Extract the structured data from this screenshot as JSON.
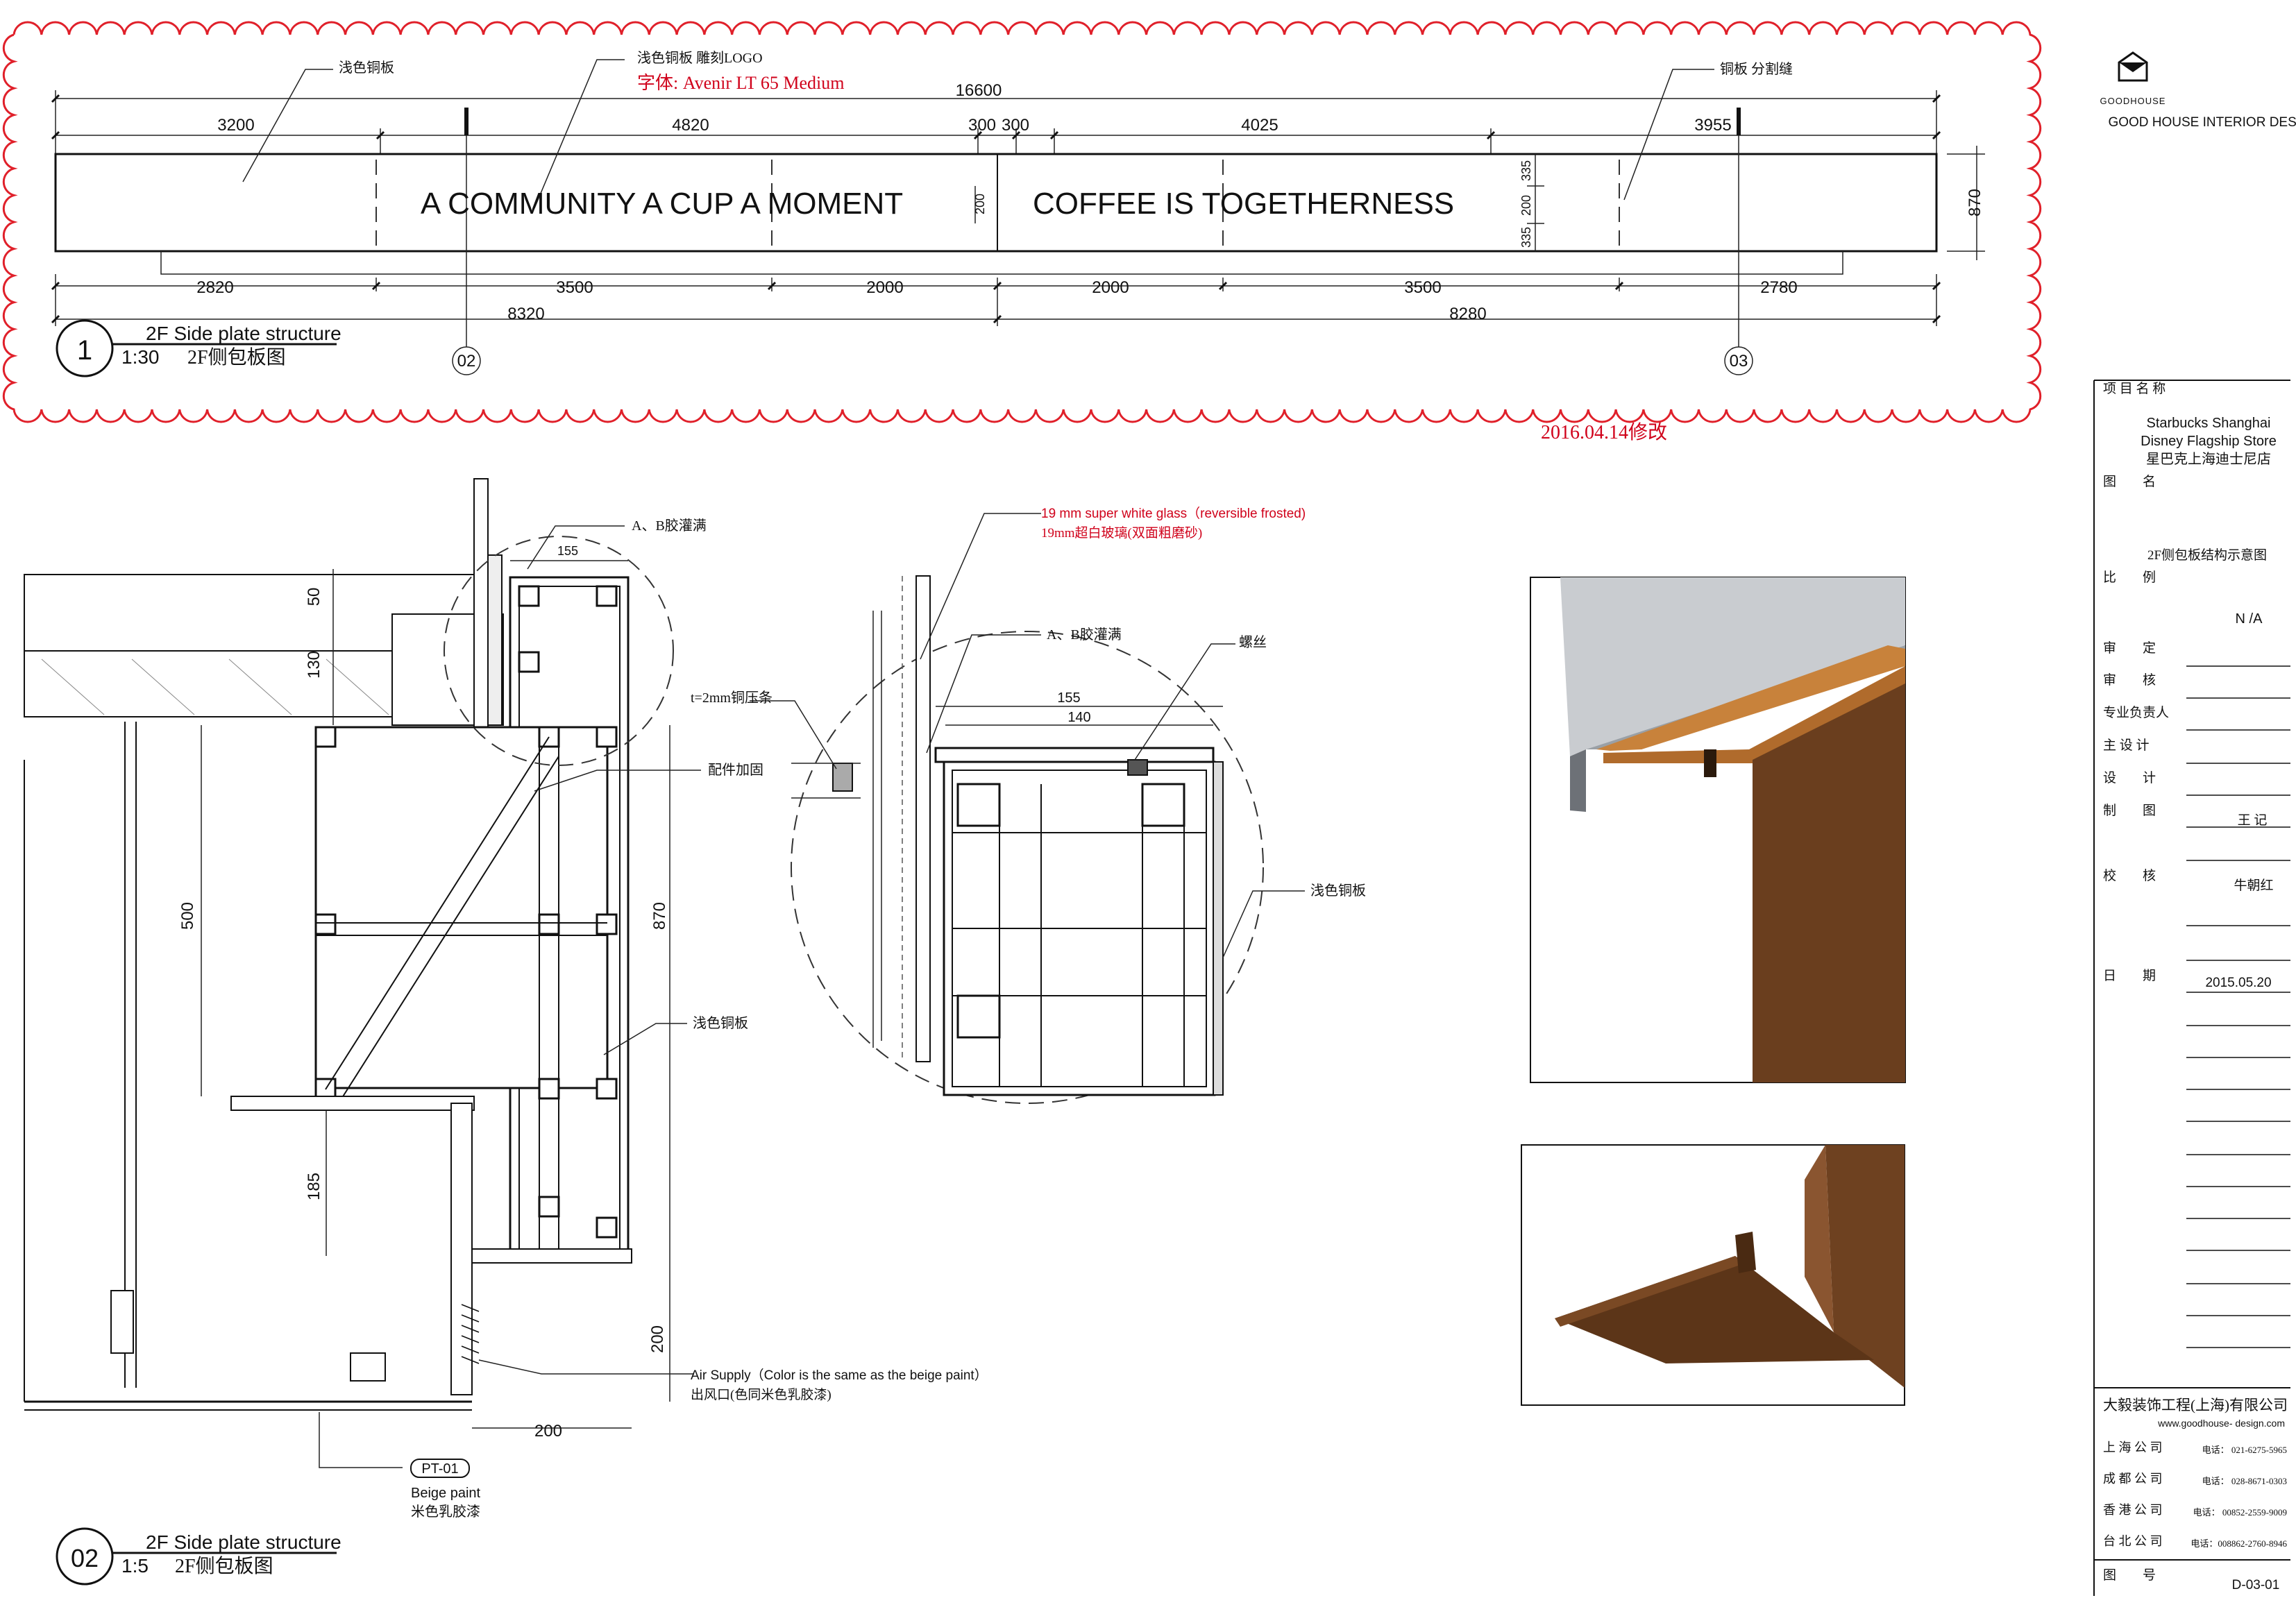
{
  "brand": {
    "company": "GOOD HOUSE INTERIOR DESIGN",
    "logo_text": "GOODHOUSE"
  },
  "elevation": {
    "slogan_left": "A COMMUNITY  A CUP  A MOMENT",
    "slogan_right": "COFFEE   IS   TOGETHERNESS",
    "note_panel": "浅色铜板",
    "note_logo": "浅色铜板 雕刻LOGO",
    "note_font": "字体: Avenir LT 65 Medium",
    "note_seam": "铜板 分割缝",
    "dim_total": "16600",
    "dims_top": [
      "3200",
      "4820",
      "300",
      "300",
      "4025",
      "3955"
    ],
    "dims_bottom": [
      "2820",
      "3500",
      "2000",
      "2000",
      "3500",
      "2780"
    ],
    "dims_half": [
      "8320",
      "8280"
    ],
    "dim_height": "870",
    "dims_text_height": [
      "200",
      "335",
      "200",
      "335"
    ],
    "callouts": [
      "02",
      "03"
    ],
    "revision": "2016.04.14修改",
    "title_num": "1",
    "title_en": "2F  Side plate structure",
    "scale": "1:30",
    "title_cn": "2F侧包板图"
  },
  "section": {
    "note_glue": "A、B胶灌满",
    "note_reinforce": "配件加固",
    "note_copper": "浅色铜板",
    "note_air_en": "Air Supply（Color is the same as the beige paint）",
    "note_air_cn": "出风口(色同米色乳胶漆)",
    "paint_code": "PT-01",
    "paint_en": "Beige paint",
    "paint_cn": "米色乳胶漆",
    "dims": [
      "155",
      "50",
      "130",
      "500",
      "870",
      "185",
      "200",
      "200"
    ],
    "title_num": "02",
    "title_en": "2F  Side plate structure",
    "scale": "1:5",
    "title_cn": "2F侧包板图"
  },
  "detail": {
    "glass_en": "19 mm super white glass（reversible frosted)",
    "glass_cn": "19mm超白玻璃(双面粗磨砂)",
    "note_glue": "A、B胶灌满",
    "note_screw": "螺丝",
    "note_strip": "t=2mm铜压条",
    "note_copper": "浅色铜板",
    "dims": [
      "155",
      "140"
    ]
  },
  "title_block": {
    "project_label": "项 目 名 称",
    "project_en_1": "Starbucks Shanghai",
    "project_en_2": "Disney Flagship Store",
    "project_cn": "星巴克上海迪士尼店",
    "drawing_label": "图　　名",
    "drawing_name": "2F侧包板结构示意图",
    "scale_label": "比　　例",
    "scale_value": "N /A",
    "review_label": "审　　定",
    "check_label": "审　　核",
    "lead_label": "专业负责人",
    "chief_label": "主 设 计",
    "design_label": "设　　计",
    "draw_label": "制　　图",
    "draw_value": "王 记",
    "proof_label": "校　　核",
    "proof_value": "牛朝红",
    "date_label": "日　　期",
    "date_value": "2015.05.20",
    "company_cn": "大毅装饰工程(上海)有限公司",
    "website": "www.goodhouse- design.com",
    "offices": [
      {
        "name": "上 海 公 司",
        "phone": "电话：  021-6275-5965"
      },
      {
        "name": "成 都 公 司",
        "phone": "电话：  028-8671-0303"
      },
      {
        "name": "香 港 公 司",
        "phone": "电话： 00852-2559-9009"
      },
      {
        "name": "台 北 公 司",
        "phone": "电话：008862-2760-8946"
      }
    ],
    "sheet_label": "图　　号",
    "sheet_value": "D-03-01"
  }
}
